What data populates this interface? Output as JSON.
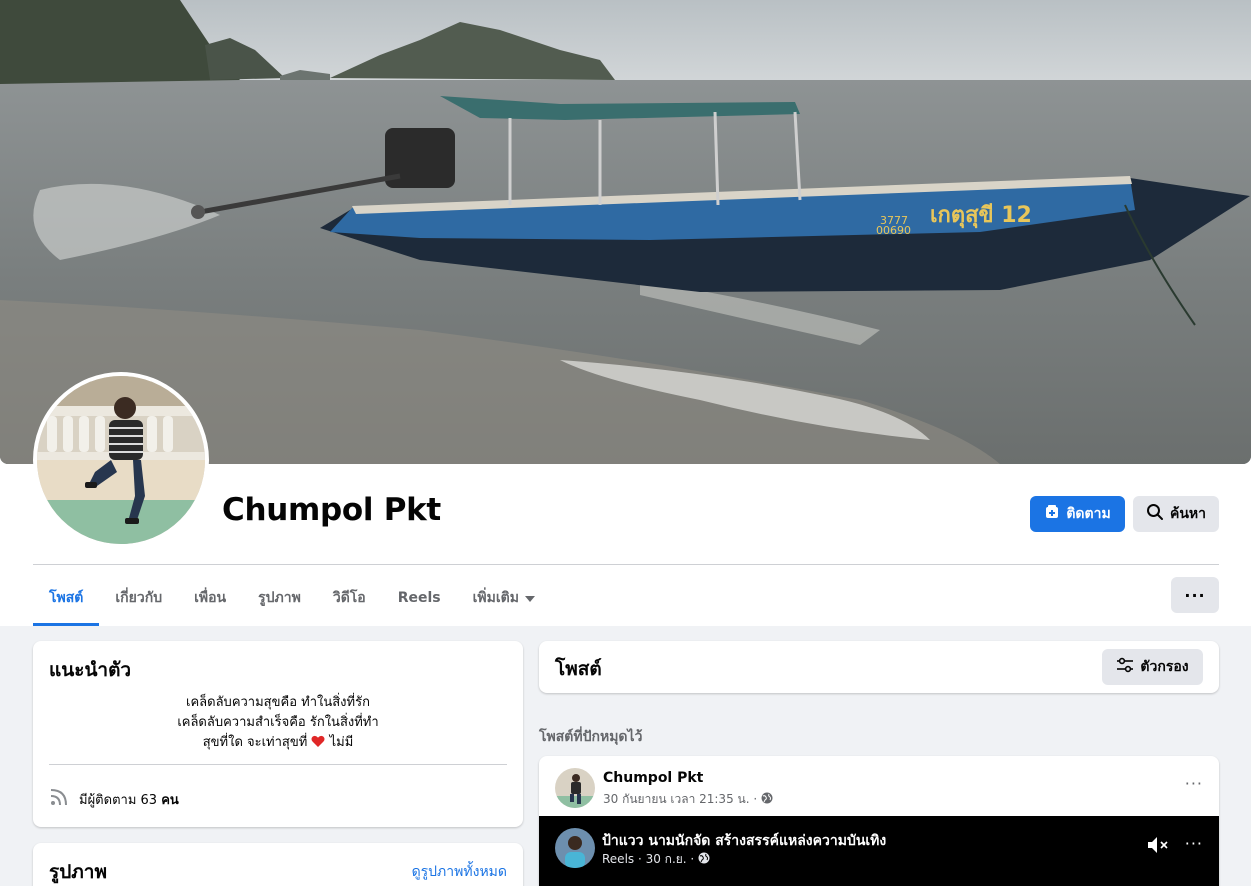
{
  "profile": {
    "name": "Chumpol Pkt",
    "follow_label": "ติดตาม",
    "search_label": "ค้นหา",
    "more_label": "···"
  },
  "tabs": [
    {
      "label": "โพสต์",
      "active": true
    },
    {
      "label": "เกี่ยวกับ"
    },
    {
      "label": "เพื่อน"
    },
    {
      "label": "รูปภาพ"
    },
    {
      "label": "วิดีโอ"
    },
    {
      "label": "Reels"
    },
    {
      "label": "เพิ่มเติม"
    }
  ],
  "intro": {
    "title": "แนะนำตัว",
    "bio_lines": [
      "เคล็ดลับความสุขคือ ทำในสิ่งที่รัก",
      "เคล็ดลับความสำเร็จคือ รักในสิ่งที่ทำ",
      "สุขที่ใด จะเท่าสุขที่",
      "ไม่มี"
    ],
    "followers_prefix": "มีผู้ติดตาม 63 ",
    "followers_suffix": "คน"
  },
  "photos": {
    "title": "รูปภาพ",
    "see_all": "ดูรูปภาพทั้งหมด"
  },
  "posts": {
    "title": "โพสต์",
    "filter_label": "ตัวกรอง",
    "pinned_label": "โพสต์ที่ปักหมุดไว้",
    "pinned_post": {
      "author": "Chumpol Pkt",
      "meta": "30 กันยายน เวลา 21:35 น. ·",
      "dots": "···",
      "reel": {
        "title": "ป้าแวว นามนักจัด สร้างสรรค์แหล่งความบันเทิง",
        "meta": "Reels · 30 ก.ย. ·",
        "dots": "···"
      }
    }
  },
  "colors": {
    "accent": "#1b74e4",
    "page_bg": "#f0f2f5",
    "secondary_button": "#e4e6eb",
    "muted_text": "#65676b"
  }
}
